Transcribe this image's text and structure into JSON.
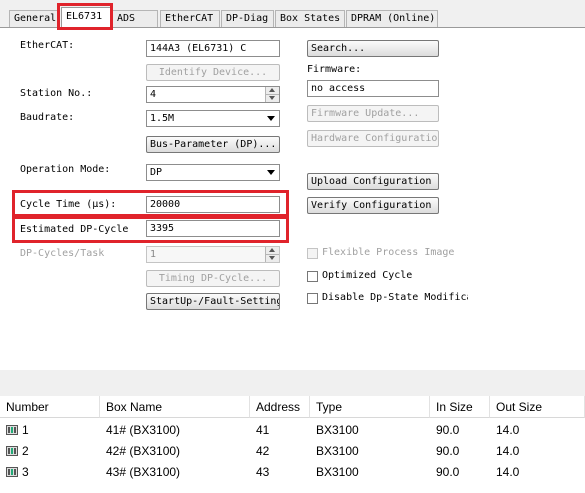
{
  "tabs": [
    "General",
    "EL6731",
    "ADS",
    "EtherCAT",
    "DP-Diag",
    "Box States",
    "DPRAM (Online)"
  ],
  "form": {
    "ethercat_label": "EtherCAT:",
    "ethercat_value": "144A3 (EL6731) C",
    "identify_device": "Identify Device...",
    "station_label": "Station No.:",
    "station_value": "4",
    "baudrate_label": "Baudrate:",
    "baudrate_value": "1.5M",
    "bus_param": "Bus-Parameter (DP)...",
    "opmode_label": "Operation Mode:",
    "opmode_value": "DP",
    "cycle_time_label": "Cycle Time (µs):",
    "cycle_time_value": "20000",
    "est_cycle_label": "Estimated DP-Cycle",
    "est_cycle_value": "3395",
    "dp_cycles_label": "DP-Cycles/Task",
    "dp_cycles_value": "1",
    "timing_dp": "Timing DP-Cycle...",
    "startup_fault": "StartUp-/Fault-Settings..."
  },
  "right": {
    "search": "Search...",
    "firmware_label": "Firmware:",
    "firmware_value": "no access",
    "firmware_update": "Firmware Update...",
    "hw_config": "Hardware Configuration...",
    "upload_config": "Upload Configuration",
    "verify_config": "Verify Configuration",
    "flexible_process": "Flexible Process Image",
    "optimized_cycle": "Optimized Cycle",
    "disable_dp_state": "Disable Dp-State Modification"
  },
  "table": {
    "columns": [
      "Number",
      "Box Name",
      "Address",
      "Type",
      "In Size",
      "Out Size"
    ],
    "rows": [
      [
        "1",
        "41# (BX3100)",
        "41",
        "BX3100",
        "90.0",
        "14.0"
      ],
      [
        "2",
        "42# (BX3100)",
        "42",
        "BX3100",
        "90.0",
        "14.0"
      ],
      [
        "3",
        "43# (BX3100)",
        "43",
        "BX3100",
        "90.0",
        "14.0"
      ]
    ]
  },
  "colors": {
    "highlight": "#e0232b"
  }
}
